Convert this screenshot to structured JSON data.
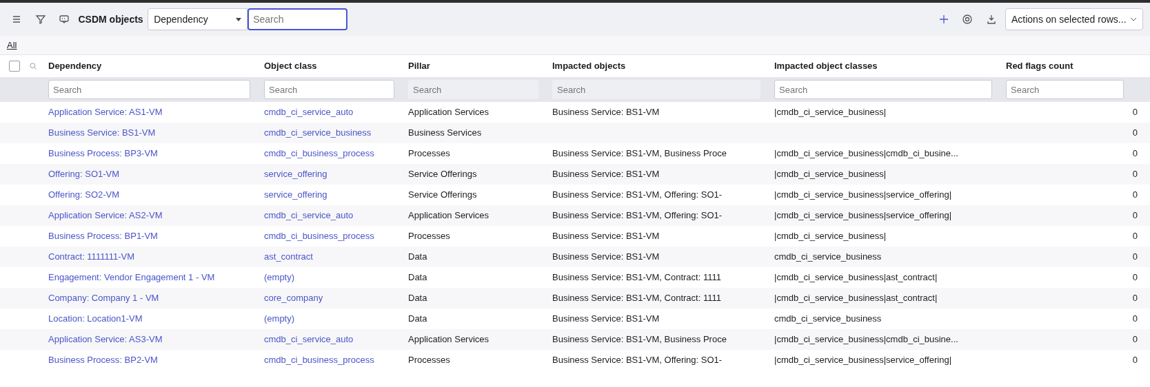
{
  "toolbar": {
    "title": "CSDM objects",
    "field_select": {
      "value": "Dependency"
    },
    "search": {
      "placeholder": "Search"
    },
    "actions_select": {
      "value": "Actions on selected rows..."
    }
  },
  "breadcrumb": "All",
  "table": {
    "select_all_checked": false,
    "columns": [
      {
        "label": "Dependency",
        "filter_placeholder": "Search",
        "filter_disabled": false,
        "kind": "link"
      },
      {
        "label": "Object class",
        "filter_placeholder": "Search",
        "filter_disabled": false,
        "kind": "link"
      },
      {
        "label": "Pillar",
        "filter_placeholder": "Search",
        "filter_disabled": true,
        "kind": "text"
      },
      {
        "label": "Impacted objects",
        "filter_placeholder": "Search",
        "filter_disabled": true,
        "kind": "text"
      },
      {
        "label": "Impacted object classes",
        "filter_placeholder": "Search",
        "filter_disabled": false,
        "kind": "text"
      },
      {
        "label": "Red flags count",
        "filter_placeholder": "Search",
        "filter_disabled": false,
        "kind": "number"
      }
    ],
    "rows": [
      [
        "Application Service: AS1-VM",
        "cmdb_ci_service_auto",
        "Application Services",
        "Business Service: BS1-VM",
        "|cmdb_ci_service_business|",
        "0"
      ],
      [
        "Business Service: BS1-VM",
        "cmdb_ci_service_business",
        "Business Services",
        "",
        "",
        "0"
      ],
      [
        "Business Process: BP3-VM",
        "cmdb_ci_business_process",
        "Processes",
        "Business Service: BS1-VM, Business Proce",
        "|cmdb_ci_service_business|cmdb_ci_busine...",
        "0"
      ],
      [
        "Offering: SO1-VM",
        "service_offering",
        "Service Offerings",
        "Business Service: BS1-VM",
        "|cmdb_ci_service_business|",
        "0"
      ],
      [
        "Offering: SO2-VM",
        "service_offering",
        "Service Offerings",
        "Business Service: BS1-VM, Offering: SO1-",
        "|cmdb_ci_service_business|service_offering|",
        "0"
      ],
      [
        "Application Service: AS2-VM",
        "cmdb_ci_service_auto",
        "Application Services",
        "Business Service: BS1-VM, Offering: SO1-",
        "|cmdb_ci_service_business|service_offering|",
        "0"
      ],
      [
        "Business Process: BP1-VM",
        "cmdb_ci_business_process",
        "Processes",
        "Business Service: BS1-VM",
        "|cmdb_ci_service_business|",
        "0"
      ],
      [
        "Contract: 1111111-VM",
        "ast_contract",
        "Data",
        "Business Service: BS1-VM",
        "cmdb_ci_service_business",
        "0"
      ],
      [
        "Engagement: Vendor Engagement 1 - VM",
        "(empty)",
        "Data",
        "Business Service: BS1-VM, Contract: 1111",
        "|cmdb_ci_service_business|ast_contract|",
        "0"
      ],
      [
        "Company: Company 1 - VM",
        "core_company",
        "Data",
        "Business Service: BS1-VM, Contract: 1111",
        "|cmdb_ci_service_business|ast_contract|",
        "0"
      ],
      [
        "Location: Location1-VM",
        "(empty)",
        "Data",
        "Business Service: BS1-VM",
        "cmdb_ci_service_business",
        "0"
      ],
      [
        "Application Service: AS3-VM",
        "cmdb_ci_service_auto",
        "Application Services",
        "Business Service: BS1-VM, Business Proce",
        "|cmdb_ci_service_business|cmdb_ci_busine...",
        "0"
      ],
      [
        "Business Process: BP2-VM",
        "cmdb_ci_business_process",
        "Processes",
        "Business Service: BS1-VM, Offering: SO1-",
        "|cmdb_ci_service_business|service_offering|",
        "0"
      ]
    ]
  }
}
